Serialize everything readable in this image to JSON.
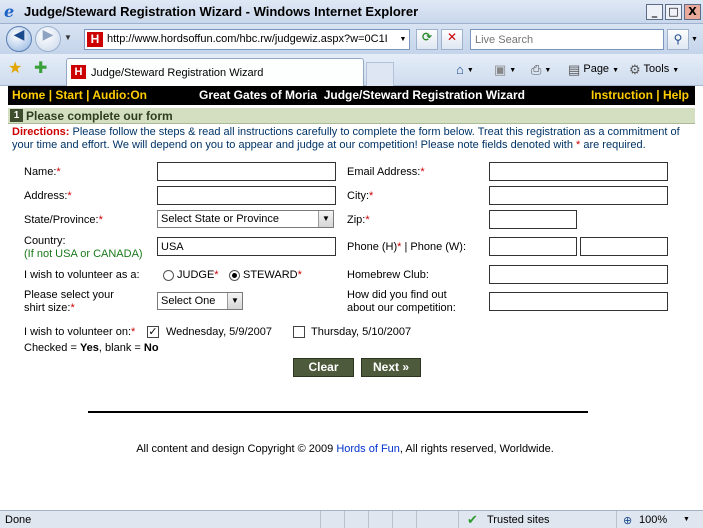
{
  "window": {
    "title": "Judge/Steward Registration Wizard - Windows Internet Explorer",
    "minimize": "_",
    "maximize": "□",
    "close": "X"
  },
  "browser": {
    "url": "http://www.hordsoffun.com/hbc.rw/judgewiz.aspx?w=0C1I",
    "search_placeholder": "Live Search",
    "tab_title": "Judge/Steward Registration Wizard",
    "favicon_letter": "H",
    "page_menu": "Page",
    "tools_menu": "Tools"
  },
  "site_nav": {
    "home": "Home",
    "start": "Start",
    "audio": "Audio:On",
    "separator": "|",
    "title": "Great Gates of Moria  Judge/Steward Registration Wizard",
    "instruction": "Instruction",
    "help": "Help"
  },
  "step": {
    "number": "1",
    "title": "Please complete our form"
  },
  "directions": {
    "label": "Directions:",
    "text_before_star": " Please follow the steps & read all instructions carefully to complete the form below. Treat this registration as a commitment of your time and effort. We will depend on you to appear and judge at our competition! Please note fields denoted with ",
    "star": "*",
    "text_after_star": " are required."
  },
  "form": {
    "required_mark": "*",
    "name_label": "Name:",
    "email_label": "Email Address:",
    "address_label": "Address:",
    "city_label": "City:",
    "state_label": "State/Province:",
    "state_value": "Select State or Province",
    "zip_label": "Zip:",
    "country_label": "Country:",
    "country_hint": "(If not USA or CANADA)",
    "country_value": "USA",
    "phone_label_h": "Phone (H)",
    "phone_label_w": " | Phone (W):",
    "volunteer_label": "I wish to volunteer as a:",
    "judge_option": "JUDGE",
    "steward_option": "STEWARD",
    "homebrew_label": "Homebrew Club:",
    "shirt_label_line1": "Please select your",
    "shirt_label_line2": "shirt size:",
    "shirt_value": "Select One",
    "found_label_line1": "How did you find out",
    "found_label_line2": "about our competition:",
    "volunteer_on_label": "I wish to volunteer on:",
    "day1_label": "Wednesday, 5/9/2007",
    "day1_checked": true,
    "day2_label": "Thursday, 5/10/2007",
    "day2_checked": false,
    "legend_checked": "Checked = ",
    "legend_yes": "Yes",
    "legend_blank": ", blank = ",
    "legend_no": "No",
    "steward_selected": true
  },
  "buttons": {
    "clear": "Clear",
    "next": "Next »"
  },
  "footer": {
    "text_before": "All content and design Copyright © 2009 ",
    "link": "Hords of Fun",
    "text_after": ", All rights reserved, Worldwide."
  },
  "status": {
    "text": "Done",
    "zone": "Trusted sites",
    "zoom": "100%"
  },
  "colors": {
    "nav_link": "#ffcc00",
    "required": "#cc0000",
    "step_bar": "#d3dfc0",
    "button": "#4e5a3c",
    "footer_link": "#0033cc"
  }
}
